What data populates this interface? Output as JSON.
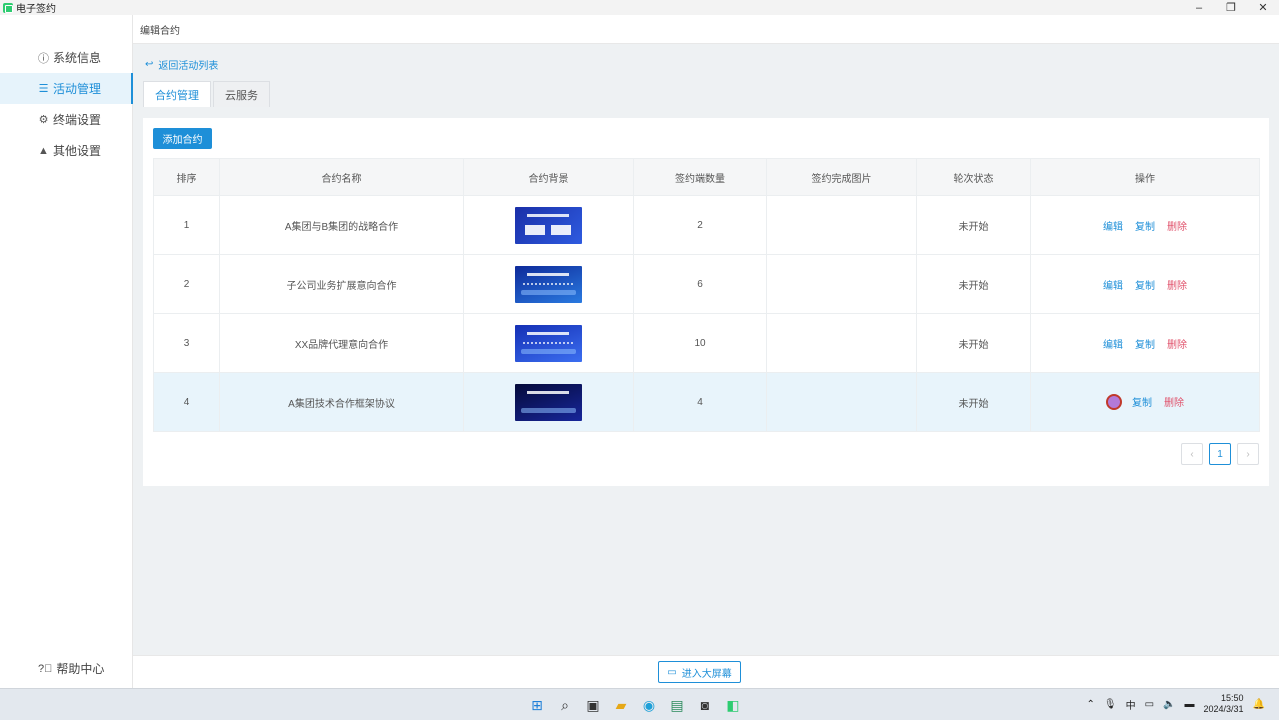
{
  "window": {
    "title": "电子签约"
  },
  "sidebar": {
    "items": [
      {
        "label": "系统信息",
        "icon": "info-icon"
      },
      {
        "label": "活动管理",
        "icon": "list-icon"
      },
      {
        "label": "终端设置",
        "icon": "gear-icon"
      },
      {
        "label": "其他设置",
        "icon": "warning-icon"
      }
    ],
    "help": "帮助中心"
  },
  "header": {
    "title": "编辑合约"
  },
  "back_link": "返回活动列表",
  "tabs": [
    {
      "label": "合约管理"
    },
    {
      "label": "云服务"
    }
  ],
  "toolbar": {
    "add_label": "添加合约"
  },
  "table": {
    "columns": [
      "排序",
      "合约名称",
      "合约背景",
      "签约端数量",
      "签约完成图片",
      "轮次状态",
      "操作"
    ],
    "rows": [
      {
        "order": "1",
        "name": "A集团与B集团的战略合作",
        "count": "2",
        "image": "",
        "status": "未开始"
      },
      {
        "order": "2",
        "name": "子公司业务扩展意向合作",
        "count": "6",
        "image": "",
        "status": "未开始"
      },
      {
        "order": "3",
        "name": "XX品牌代理意向合作",
        "count": "10",
        "image": "",
        "status": "未开始"
      },
      {
        "order": "4",
        "name": "A集团技术合作框架协议",
        "count": "4",
        "image": "",
        "status": "未开始"
      }
    ],
    "actions": {
      "edit": "编辑",
      "copy": "复制",
      "delete": "删除"
    }
  },
  "pager": {
    "current": "1"
  },
  "footer": {
    "bigscreen_label": "进入大屏幕"
  },
  "taskbar": {
    "ime": "中",
    "time": "15:50",
    "date": "2024/3/31"
  },
  "colors": {
    "accent": "#1e8fd8",
    "danger": "#e0506a"
  }
}
